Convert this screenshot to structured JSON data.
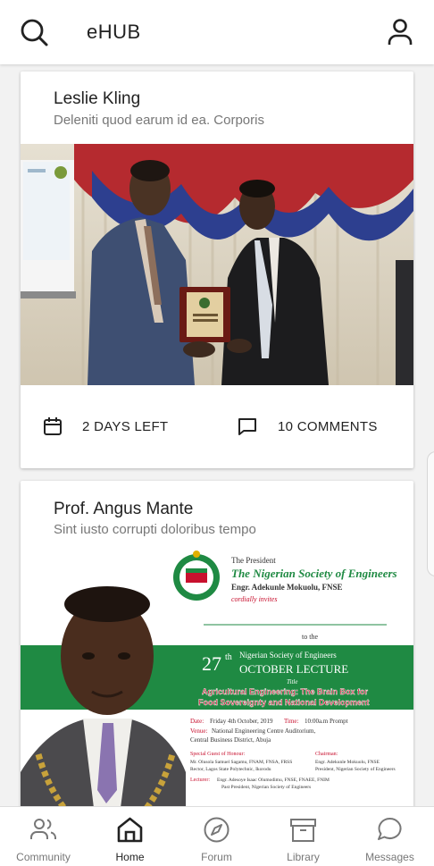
{
  "app": {
    "title": "eHUB"
  },
  "header": {
    "search_icon": "search-icon",
    "profile_icon": "user-icon"
  },
  "posts": [
    {
      "author": "Leslie Kling",
      "subtitle": "Deleniti quod earum id ea. Corporis",
      "image": "award-presentation-photo",
      "days_left": "2 DAYS LEFT",
      "comments": "10 COMMENTS"
    },
    {
      "author": "Prof. Angus Mante",
      "subtitle": "Sint iusto corrupti doloribus tempo",
      "image": "lecture-invitation-flyer",
      "flyer": {
        "presenter_line": "The President",
        "society": "The Nigerian Society of Engineers",
        "president": "Engr. Adekunle Mokuolu, FNSE",
        "invites": "cordially invites",
        "to_the": "to the",
        "ordinal_number": "27",
        "ordinal_suffix": "th",
        "lecture_line1": "Nigerian Society of Engineers",
        "lecture_line2": "OCTOBER LECTURE",
        "title_label": "Title",
        "topic_line1": "Agricultural Engineering: The Brain Box for",
        "topic_line2": "Food Sovereignty and National Development",
        "date_label": "Date:",
        "date_value": "Friday 4th October, 2019",
        "time_label": "Time:",
        "time_value": "10:00a.m Prompt",
        "venue_label": "Venue:",
        "venue_line1": "National Engineering Centre Auditorium,",
        "venue_line2": "Central Business District, Abuja",
        "guest_label": "Special Guest of Honour:",
        "guest_line1": "Mr. Olusola Samuel Sagamu, FNAM, FNSA, FRSS",
        "guest_line2": "Rector, Lagos State Polytechnic, Ikorodu",
        "chairman_label": "Chairman:",
        "chairman_line1": "Engr. Adekunle Mokuolu, FNSE",
        "chairman_line2": "President, Nigerian Society of Engineers",
        "lecturer_label": "Lecturer:",
        "lecturer_line1": "Engr. Adesoye Isaac Olumodimu, FNSE, FNAEE, FNIM",
        "lecturer_line2": "Past President, Nigerian Society of Engineers"
      }
    }
  ],
  "bottom_nav": [
    {
      "label": "Community",
      "icon": "community-icon",
      "active": false
    },
    {
      "label": "Home",
      "icon": "home-icon",
      "active": true
    },
    {
      "label": "Forum",
      "icon": "compass-icon",
      "active": false
    },
    {
      "label": "Library",
      "icon": "archive-icon",
      "active": false
    },
    {
      "label": "Messages",
      "icon": "chat-bubble-icon",
      "active": false
    }
  ],
  "colors": {
    "accent_green": "#1f8a43",
    "flyer_red": "#c8102e",
    "nav_active": "#222222",
    "nav_inactive": "#777777"
  }
}
